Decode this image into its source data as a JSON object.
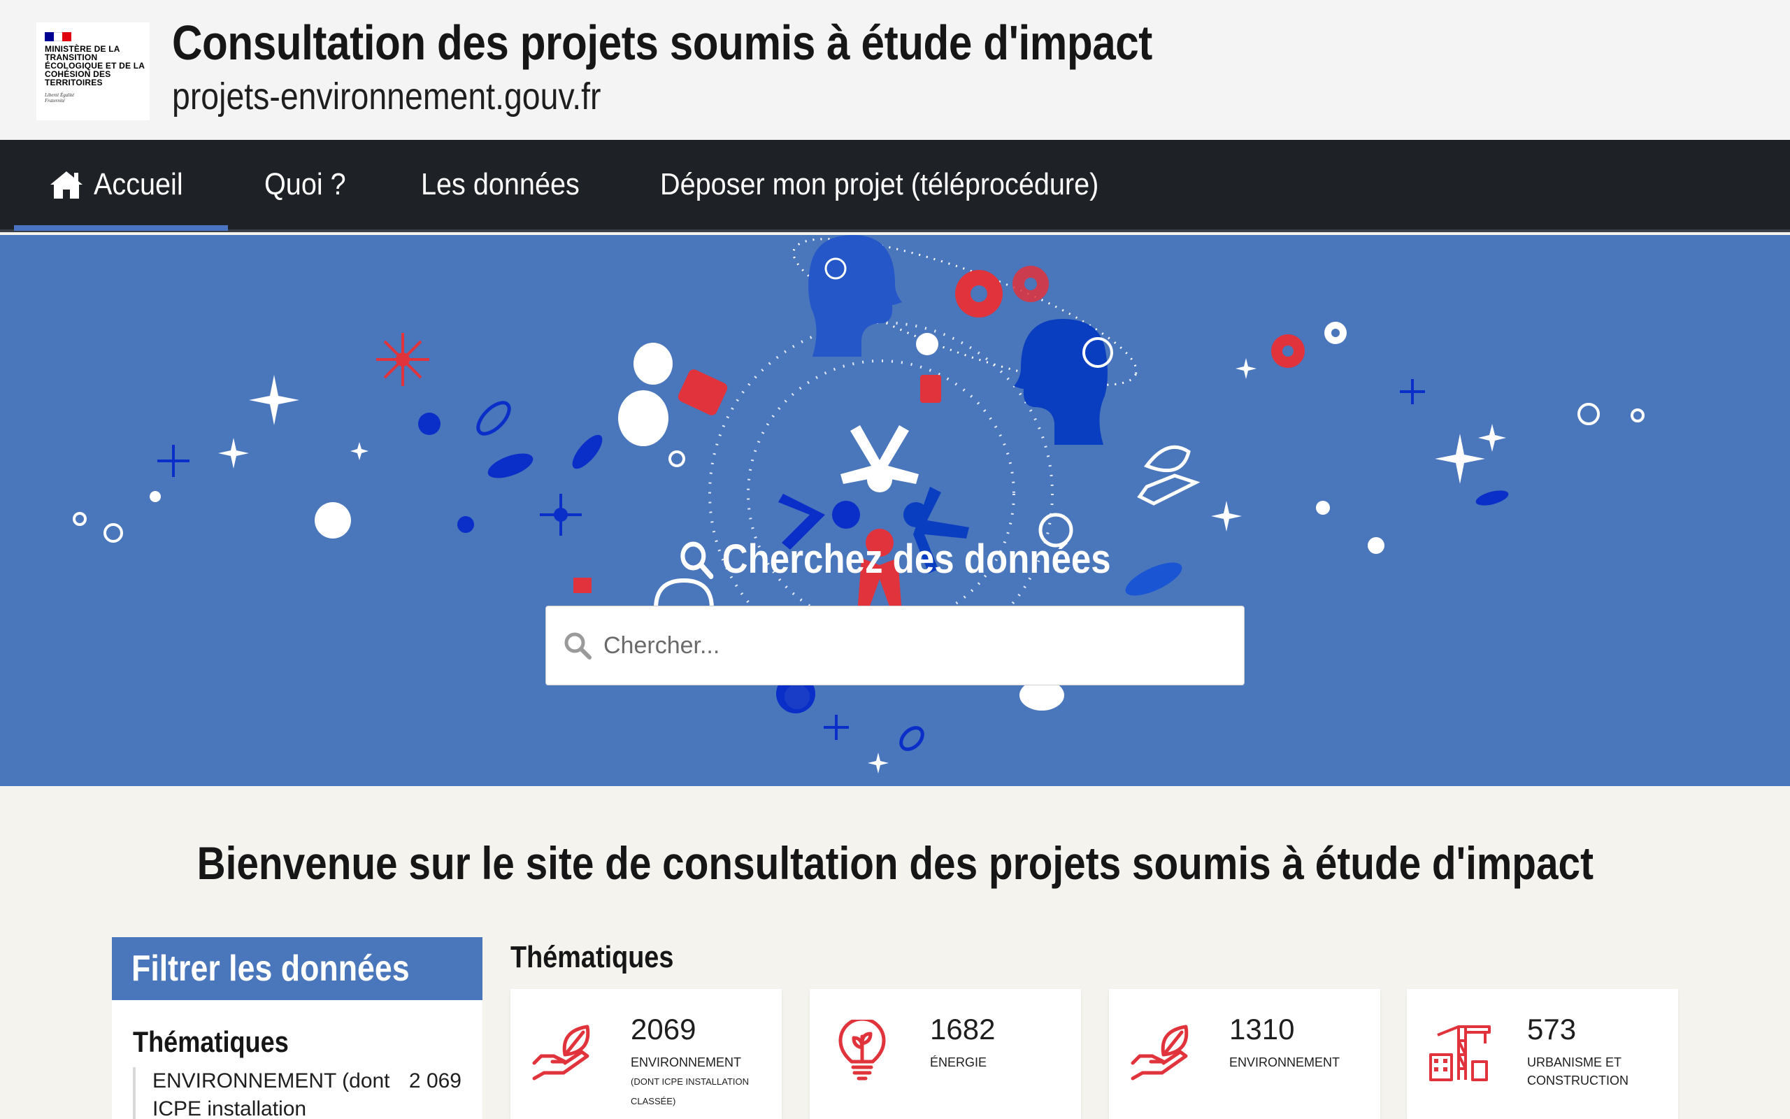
{
  "header": {
    "logo_lines": "Ministère de la transition écologique et de la cohésion des territoires",
    "logo_motto": "Liberté Égalité Fraternité",
    "title": "Consultation des projets soumis à étude d'impact",
    "subtitle": "projets-environnement.gouv.fr"
  },
  "nav": {
    "items": [
      {
        "label": "Accueil",
        "icon": "home-icon",
        "active": true
      },
      {
        "label": "Quoi ?"
      },
      {
        "label": "Les données"
      },
      {
        "label": "Déposer mon projet (téléprocédure)"
      }
    ]
  },
  "hero": {
    "heading": "Cherchez des données",
    "search_placeholder": "Chercher..."
  },
  "welcome": {
    "title": "Bienvenue sur le site de consultation des projets soumis à étude d'impact"
  },
  "filter": {
    "title": "Filtrer les données",
    "section": "Thématiques",
    "items": [
      {
        "label": "ENVIRONNEMENT (dont ICPE installation classée)",
        "count": "2 069"
      }
    ]
  },
  "thematiques": {
    "title": "Thématiques",
    "cards": [
      {
        "count": "2069",
        "label": "Environnement",
        "sublabel": "(dont ICPE installation classée)",
        "icon": "leaf-hand-icon"
      },
      {
        "count": "1682",
        "label": "Énergie",
        "icon": "lightbulb-plant-icon"
      },
      {
        "count": "1310",
        "label": "Environnement",
        "icon": "leaf-hand-icon"
      },
      {
        "count": "573",
        "label": "Urbanisme et construction",
        "icon": "crane-building-icon"
      }
    ]
  },
  "colors": {
    "nav_bg": "#1e2126",
    "hero_bg": "#4a76bc",
    "accent_red": "#e1000f",
    "accent_blue": "#000091"
  }
}
